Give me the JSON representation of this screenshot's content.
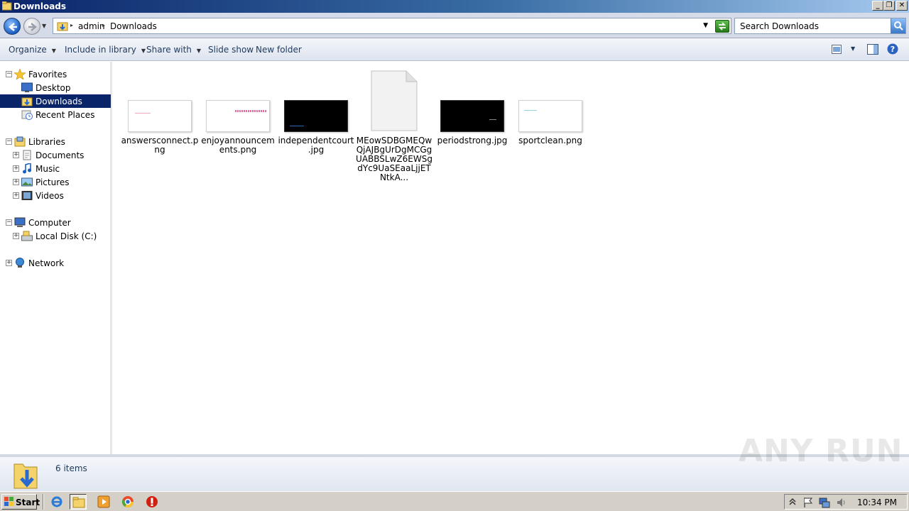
{
  "window": {
    "title": "Downloads",
    "buttons": {
      "minimize": "_",
      "restore": "❐",
      "close": "✕"
    }
  },
  "address": {
    "crumbs": [
      "admin",
      "Downloads"
    ],
    "search_placeholder": "Search Downloads"
  },
  "toolbar": {
    "organize": "Organize",
    "include_in_library": "Include in library",
    "share_with": "Share with",
    "slide_show": "Slide show",
    "new_folder": "New folder"
  },
  "nav": {
    "favorites": "Favorites",
    "desktop": "Desktop",
    "downloads": "Downloads",
    "recent_places": "Recent Places",
    "libraries": "Libraries",
    "documents": "Documents",
    "music": "Music",
    "pictures": "Pictures",
    "videos": "Videos",
    "computer": "Computer",
    "local_disk": "Local Disk (C:)",
    "network": "Network"
  },
  "files": [
    {
      "name": "answersconnect.png",
      "thumb": "white-pink"
    },
    {
      "name": "enjoyannouncements.png",
      "thumb": "white-pinkright"
    },
    {
      "name": "independentcourt.jpg",
      "thumb": "black-blue"
    },
    {
      "name": "MEowSDBGMEQwQjAJBgUrDgMCGgUABBSLwZ6EWSgdYc9UaSEaaLjjETNtkA...",
      "thumb": "generic"
    },
    {
      "name": "periodstrong.jpg",
      "thumb": "black-right"
    },
    {
      "name": "sportclean.png",
      "thumb": "white-blue"
    }
  ],
  "details": {
    "count": "6 items"
  },
  "watermark": "ANY RUN",
  "taskbar": {
    "start": "Start",
    "clock": "10:34 PM"
  }
}
